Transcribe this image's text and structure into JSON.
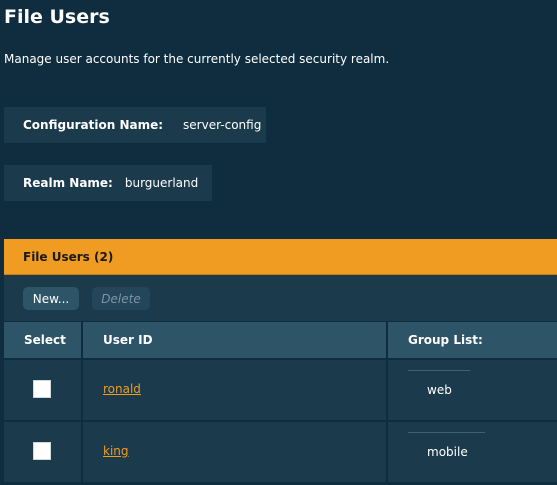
{
  "page": {
    "title": "File Users",
    "description": "Manage user accounts for the currently selected security realm."
  },
  "config": {
    "label": "Configuration Name:",
    "value": "server-config"
  },
  "realm": {
    "label": "Realm Name:",
    "value": "burguerland"
  },
  "panel": {
    "title": "File Users (2)"
  },
  "toolbar": {
    "new_label": "New...",
    "delete_label": "Delete"
  },
  "table": {
    "columns": [
      "Select",
      "User ID",
      "Group List:"
    ],
    "rows": [
      {
        "user_id": "ronald",
        "groups": "web",
        "selected": false
      },
      {
        "user_id": "king",
        "groups": "mobile",
        "selected": false
      }
    ]
  },
  "colors": {
    "background": "#0f2d3e",
    "accent": "#f09b22",
    "row_background": "#1b3b4d",
    "header_background": "#2e5468"
  }
}
